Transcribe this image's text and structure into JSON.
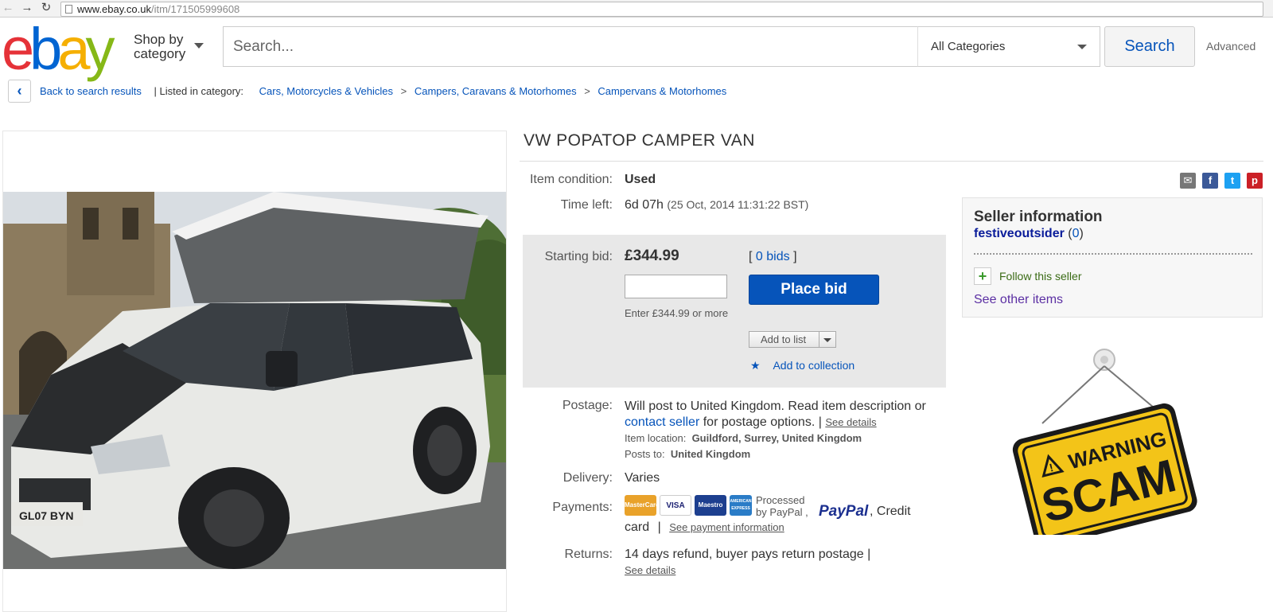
{
  "browser": {
    "url_host": "www.ebay.co.uk",
    "url_path": "/itm/171505999608"
  },
  "header": {
    "logo": [
      "e",
      "b",
      "a",
      "y"
    ],
    "shop_by": "Shop by",
    "category": "category",
    "search_placeholder": "Search...",
    "category_select": "All Categories",
    "search_button": "Search",
    "advanced": "Advanced"
  },
  "breadcrumb": {
    "back": "Back to search results",
    "listed_in": "| Listed in category:",
    "crumbs": [
      "Cars, Motorcycles & Vehicles",
      "Campers, Caravans & Motorhomes",
      "Campervans & Motorhomes"
    ],
    "separator": ">"
  },
  "item": {
    "title": "VW POPATOP CAMPER VAN",
    "condition_label": "Item condition:",
    "condition": "Used",
    "time_left_label": "Time left:",
    "time_left": "6d 07h",
    "end_time": "(25 Oct, 2014  11:31:22 BST)",
    "starting_bid_label": "Starting bid:",
    "starting_bid": "£344.99",
    "bids_open": "[",
    "bids": "0 bids",
    "bids_close": "]",
    "enter_hint": "Enter £344.99 or more",
    "place_bid": "Place bid",
    "add_to_list": "Add to list",
    "add_to_collection": "Add to collection"
  },
  "postage": {
    "label": "Postage:",
    "text_1": "Will post to United Kingdom. Read item description or",
    "contact_seller": "contact seller",
    "text_2": "for postage options. |",
    "see_details": "See details",
    "location_label": "Item location:",
    "location": "Guildford, Surrey, United Kingdom",
    "posts_to_label": "Posts to:",
    "posts_to": "United Kingdom"
  },
  "delivery": {
    "label": "Delivery:",
    "value": "Varies"
  },
  "payments": {
    "label": "Payments:",
    "cards": [
      "MasterCard",
      "VISA",
      "Maestro",
      "AMERICAN EXPRESS"
    ],
    "processed_1": "Processed",
    "processed_2": "by PayPal ,",
    "paypal": "PayPal",
    "credit_1": ",  Credit",
    "credit_2": "card",
    "pipe": "|",
    "see_info": "See payment information"
  },
  "returns": {
    "label": "Returns:",
    "value": "14 days refund, buyer pays return postage |",
    "see_details": "See details"
  },
  "seller": {
    "heading": "Seller information",
    "name": "festiveoutsider",
    "feedback_open": "(",
    "feedback": "0",
    "feedback_close": ")",
    "follow": "Follow this seller",
    "see_other": "See other items"
  },
  "sign": {
    "warning": "WARNING",
    "scam": "SCAM"
  },
  "photo": {
    "plate": "GL07 BYN"
  },
  "colors": {
    "link": "#0654ba",
    "place_bid": "#0654ba",
    "sign_yellow": "#f3c418",
    "seller_link": "#0a1c9a"
  }
}
